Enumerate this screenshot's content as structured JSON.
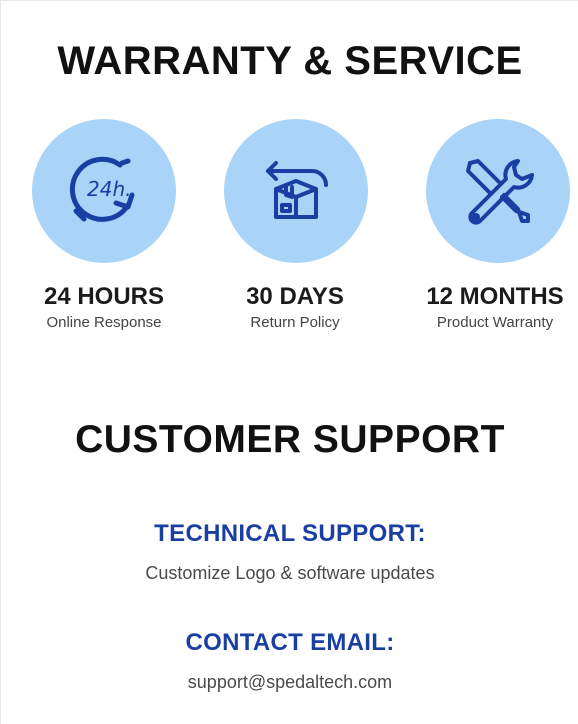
{
  "warranty": {
    "title": "WARRANTY & SERVICE",
    "features": [
      {
        "value": "24 HOURS",
        "caption": "Online Response",
        "icon": "clock-24h-icon"
      },
      {
        "value": "30 DAYS",
        "caption": "Return Policy",
        "icon": "return-box-icon"
      },
      {
        "value": "12 MONTHS",
        "caption": "Product Warranty",
        "icon": "tools-icon"
      }
    ],
    "icon_circle_color": "#a9d3f7",
    "icon_stroke_color": "#1a3fa3"
  },
  "support": {
    "title": "CUSTOMER SUPPORT",
    "technical_heading": "TECHNICAL SUPPORT:",
    "technical_text": "Customize Logo & software updates",
    "email_heading": "CONTACT EMAIL:",
    "email_text": "support@spedaltech.com",
    "heading_color": "#1a3fa3"
  }
}
